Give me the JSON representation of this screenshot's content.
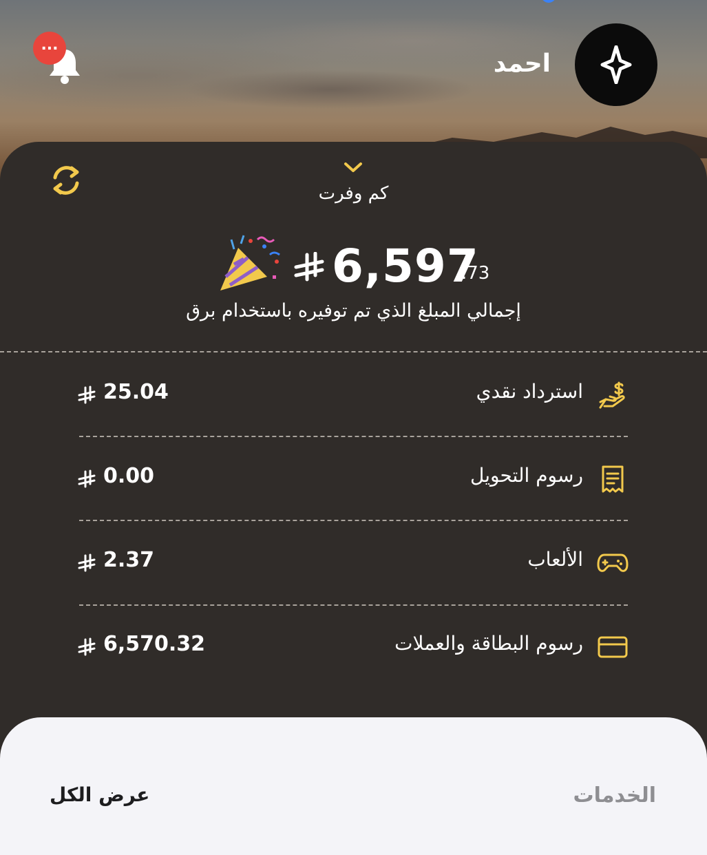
{
  "header": {
    "username": "احمد",
    "notification_badge": "..."
  },
  "savings": {
    "toggle_label": "كم وفرت",
    "total_integer": "6,597",
    "total_decimal": ".73",
    "subtitle": "إجمالي المبلغ الذي تم توفيره باستخدام برق"
  },
  "breakdown": [
    {
      "label": "استرداد نقدي",
      "amount": "25.04",
      "icon": "cashback-hand-icon"
    },
    {
      "label": "رسوم التحويل",
      "amount": "0.00",
      "icon": "receipt-icon"
    },
    {
      "label": "الألعاب",
      "amount": "2.37",
      "icon": "gamepad-icon"
    },
    {
      "label": "رسوم البطاقة والعملات",
      "amount": "6,570.32",
      "icon": "credit-card-icon"
    }
  ],
  "services": {
    "title": "الخدمات",
    "view_all": "عرض الكل"
  },
  "colors": {
    "accent": "#f2c94c",
    "card_bg": "#302c29",
    "badge": "#e8453c",
    "sheet_bg": "#f4f4f8"
  }
}
